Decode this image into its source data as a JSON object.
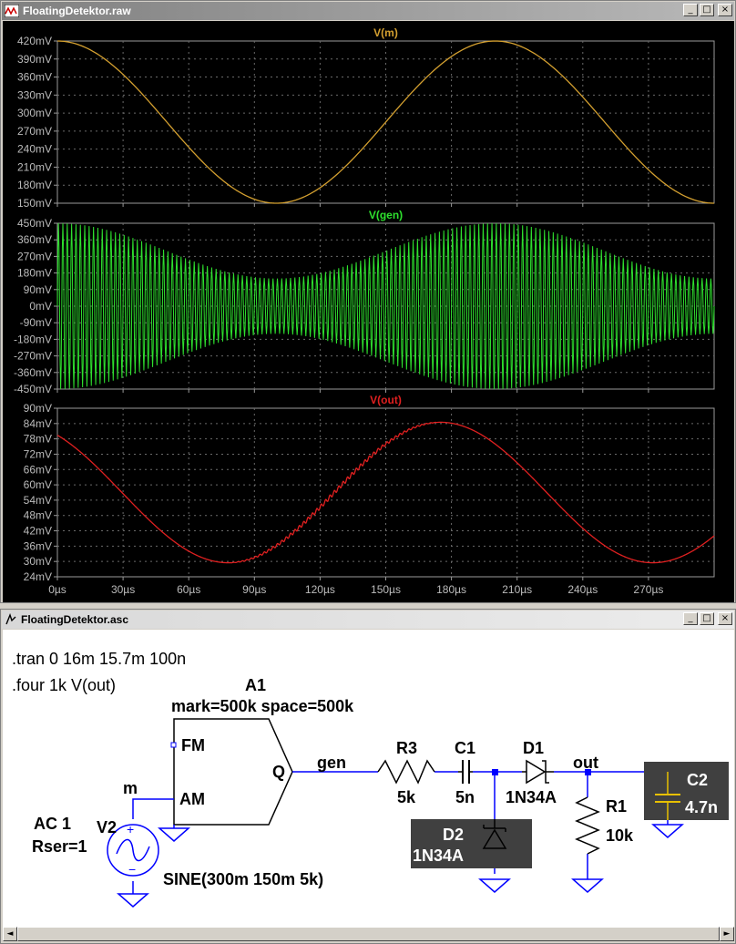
{
  "waveform_window": {
    "title": "FloatingDetektor.raw",
    "buttons": {
      "minimize": "_",
      "maximize": "□",
      "close": "×"
    }
  },
  "chart_data": [
    {
      "type": "line",
      "title": "V(m)",
      "series": [
        {
          "name": "V(m)",
          "color": "#d4a030",
          "offset_mv": 300,
          "amplitude_mv": 150,
          "freq_khz": 5,
          "phase": "cosine"
        }
      ],
      "xlim": [
        0,
        300
      ],
      "xunit": "µs",
      "ylim": [
        150,
        450
      ],
      "yticks": [
        "420mV",
        "390mV",
        "360mV",
        "330mV",
        "300mV",
        "270mV",
        "240mV",
        "210mV",
        "180mV",
        "150mV"
      ],
      "grid": true
    },
    {
      "type": "line",
      "title": "V(gen)",
      "series": [
        {
          "name": "V(gen)",
          "color": "#2ee02e",
          "carrier_khz": 500,
          "envelope": "V(m)"
        }
      ],
      "xlim": [
        0,
        300
      ],
      "xunit": "µs",
      "ylim": [
        -450,
        450
      ],
      "yticks": [
        "450mV",
        "360mV",
        "270mV",
        "180mV",
        "90mV",
        "0mV",
        "-90mV",
        "-180mV",
        "-270mV",
        "-360mV",
        "-450mV"
      ],
      "grid": true
    },
    {
      "type": "line",
      "title": "V(out)",
      "series": [
        {
          "name": "V(out)",
          "color": "#e02020",
          "offset_mv": 57,
          "amplitude_mv": 27.5,
          "min_at_us": 78,
          "max_at_us": 175
        }
      ],
      "xlim": [
        0,
        300
      ],
      "xunit": "µs",
      "ylim": [
        24,
        90
      ],
      "yticks": [
        "90mV",
        "84mV",
        "78mV",
        "72mV",
        "66mV",
        "60mV",
        "54mV",
        "48mV",
        "42mV",
        "36mV",
        "30mV",
        "24mV"
      ],
      "xticks": [
        "0µs",
        "30µs",
        "60µs",
        "90µs",
        "120µs",
        "150µs",
        "180µs",
        "210µs",
        "240µs",
        "270µs"
      ],
      "grid": true
    }
  ],
  "schematic_window": {
    "title": "FloatingDetektor.asc",
    "buttons": {
      "minimize": "_",
      "maximize": "□",
      "close": "×"
    },
    "directives": [
      ".tran 0 16m 15.7m 100n",
      ".four 1k V(out)"
    ],
    "a1": {
      "name": "A1",
      "params": "mark=500k space=500k",
      "pin_fm": "FM",
      "pin_am": "AM",
      "pin_q": "Q"
    },
    "v2": {
      "name": "V2",
      "label_ac": "AC 1",
      "label_rser": "Rser=1",
      "value": "SINE(300m 150m 5k)"
    },
    "nets": {
      "m": "m",
      "gen": "gen",
      "out": "out"
    },
    "r3": {
      "name": "R3",
      "value": "5k"
    },
    "c1": {
      "name": "C1",
      "value": "5n"
    },
    "d1": {
      "name": "D1",
      "value": "1N34A"
    },
    "d2": {
      "name": "D2",
      "value": "1N34A"
    },
    "r1": {
      "name": "R1",
      "value": "10k"
    },
    "c2": {
      "name": "C2",
      "value": "4.7n"
    },
    "scrollbar": {
      "left": "◄",
      "right": "►"
    }
  }
}
